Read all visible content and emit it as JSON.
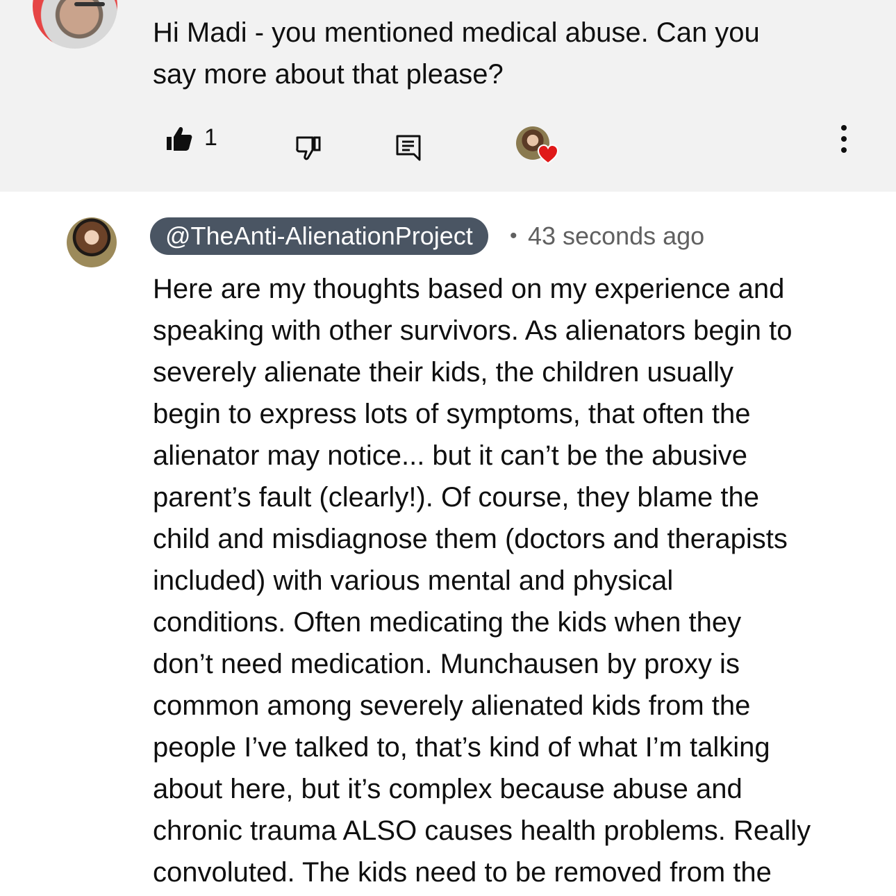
{
  "parent_comment": {
    "text": "Hi Madi - you mentioned medical abuse. Can you\nsay more about that please?",
    "like_count": "1"
  },
  "icons": {
    "like": "thumbs-up-filled-icon",
    "dislike": "thumbs-down-outline-icon",
    "reply": "reply-comment-icon",
    "creator_heart": "creator-heart-icon",
    "more": "more-vertical-icon"
  },
  "reply_comment": {
    "author": "@TheAnti-AlienationProject",
    "separator": "•",
    "timestamp": "43 seconds ago",
    "text": "Here are my thoughts based on my experience and\nspeaking with other survivors. As alienators begin to\nseverely alienate their kids, the children usually\nbegin to express lots of symptoms, that often the\nalienator may notice... but it can’t be the abusive\nparent’s fault (clearly!). Of course, they blame the\nchild and misdiagnose them (doctors and therapists\nincluded) with various mental and physical\nconditions. Often medicating the kids when they\ndon’t need medication. Munchausen by proxy is\ncommon among severely alienated kids from the\npeople I’ve talked to, that’s kind of what I’m talking\nabout here, but it’s complex because abuse and\nchronic trauma ALSO causes health problems. Really\nconvoluted. The kids need to be removed from the"
  },
  "colors": {
    "highlight_bg": "#f2f2f2",
    "author_chip_bg": "#4a5563",
    "heart": "#e01919",
    "meta_text": "#606060"
  }
}
